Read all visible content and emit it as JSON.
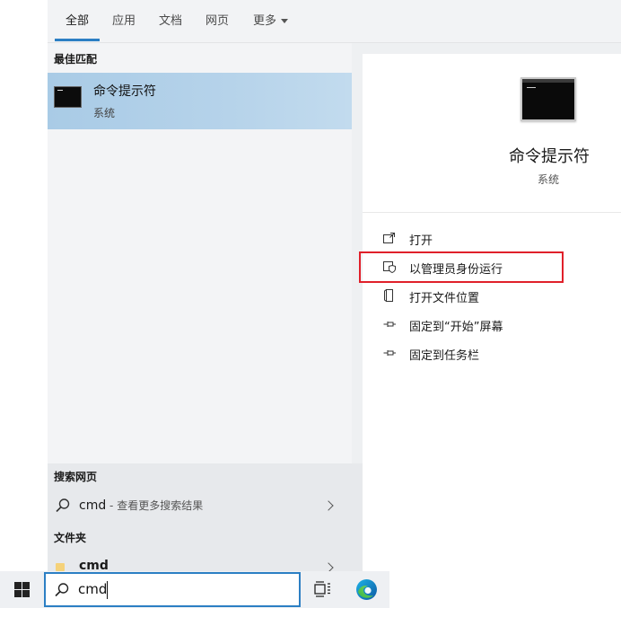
{
  "tabs": [
    {
      "label": "全部"
    },
    {
      "label": "应用"
    },
    {
      "label": "文档"
    },
    {
      "label": "网页"
    },
    {
      "label": "更多"
    }
  ],
  "best_match": {
    "section_title": "最佳匹配",
    "name": "命令提示符",
    "type": "系统",
    "icon": "command-prompt-icon"
  },
  "detail": {
    "title": "命令提示符",
    "subtitle": "系统",
    "actions": [
      {
        "label": "打开",
        "icon": "open-icon"
      },
      {
        "label": "以管理员身份运行",
        "icon": "shield-icon",
        "highlighted": true
      },
      {
        "label": "打开文件位置",
        "icon": "file-location-icon"
      },
      {
        "label": "固定到“开始”屏幕",
        "icon": "pin-icon"
      },
      {
        "label": "固定到任务栏",
        "icon": "pin-icon"
      }
    ]
  },
  "web_search": {
    "section_title": "搜索网页",
    "query": "cmd",
    "hint": " - 查看更多搜索结果"
  },
  "folders": {
    "section_title": "文件夹",
    "items": [
      {
        "name": "cmd"
      }
    ]
  },
  "taskbar": {
    "search_value": "cmd"
  },
  "colors": {
    "accent": "#2c7fc4",
    "selection": "#a9cbe6",
    "highlight_border": "#e0202a"
  }
}
